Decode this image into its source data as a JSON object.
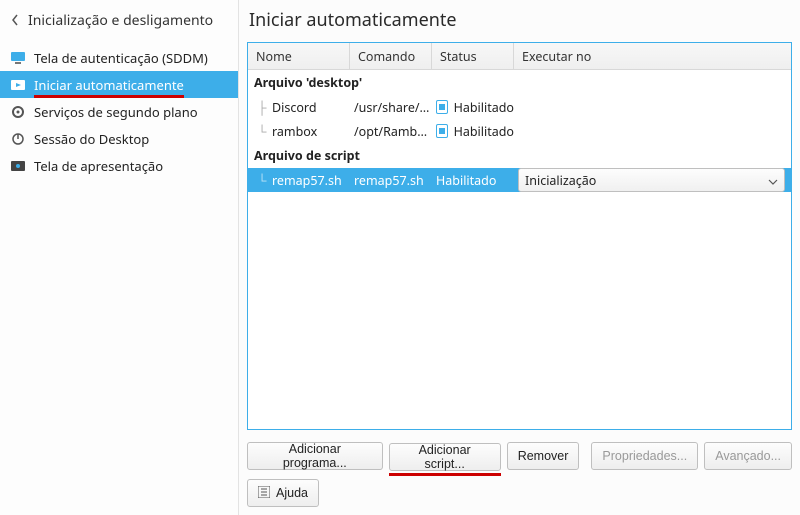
{
  "sidebar": {
    "title": "Inicialização e desligamento",
    "items": [
      {
        "label": "Tela de autenticação (SDDM)"
      },
      {
        "label": "Iniciar automaticamente"
      },
      {
        "label": "Serviços de segundo plano"
      },
      {
        "label": "Sessão do Desktop"
      },
      {
        "label": "Tela de apresentação"
      }
    ]
  },
  "main": {
    "title": "Iniciar automaticamente",
    "columns": {
      "name": "Nome",
      "command": "Comando",
      "status": "Status",
      "run": "Executar no"
    },
    "groups": {
      "desktop": "Arquivo 'desktop'",
      "script": "Arquivo de script"
    },
    "rows": {
      "discord": {
        "name": "Discord",
        "cmd": "/usr/share/di...",
        "status": "Habilitado"
      },
      "rambox": {
        "name": "rambox",
        "cmd": "/opt/Rambox...",
        "status": "Habilitado"
      },
      "remap": {
        "name": "remap57.sh",
        "cmd": "remap57.sh",
        "status": "Habilitado",
        "run": "Inicialização"
      }
    },
    "buttons": {
      "add_program": "Adicionar programa...",
      "add_script": "Adicionar script...",
      "remove": "Remover",
      "properties": "Propriedades...",
      "advanced": "Avançado...",
      "help": "Ajuda"
    }
  }
}
